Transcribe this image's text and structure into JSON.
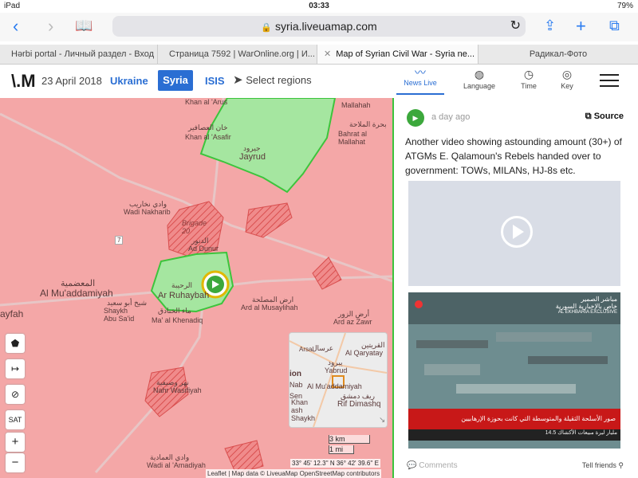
{
  "status": {
    "device": "iPad",
    "time": "03:33",
    "battery": "79%"
  },
  "browser": {
    "url": "syria.liveuamap.com",
    "tabs": [
      {
        "label": "Hərbi portal - Личный раздел - Вход"
      },
      {
        "label": "Страница 7592 | WarOnline.org | И..."
      },
      {
        "label": "Map of Syrian Civil War - Syria ne..."
      },
      {
        "label": "Радикал-Фото"
      }
    ]
  },
  "header": {
    "date": "23 April 2018",
    "links": {
      "ukraine": "Ukraine",
      "syria": "Syria",
      "isis": "ISIS"
    },
    "select_regions": "Select regions",
    "tabs": {
      "news": "News Live",
      "language": "Language",
      "time": "Time",
      "key": "Key"
    }
  },
  "map": {
    "labels": {
      "khan_arus": "Khan al 'Arus",
      "mallahah": "Mallahah",
      "khan_asafir_ar": "خان العصافير",
      "khan_asafir": "Khan al 'Asafir",
      "bahrat_ar": "بحرة الملاحة",
      "bahrat": "Bahrat al Mallahat",
      "jayrud_ar": "جيرود",
      "jayrud": "Jayrud",
      "wadi_ar": "وادي نخاريب",
      "wadi": "Wadi Nakharib",
      "brigade": "Brigade 20",
      "ad_dunur_ar": "الدنور",
      "ad_dunur": "Ad Dunur",
      "muad_ar": "المعضمية",
      "muad": "Al Mu'addamiyah",
      "ayfah": "ayfah",
      "ruhayba_ar": "الرحيبة",
      "ruhayba": "Ar Ruhaybah",
      "shaykh_ar": "شيخ أبو سعيد",
      "shaykh": "Shaykh Abu Sa'id",
      "khenadiq_ar": "ماء الخنادق",
      "khenadiq": "Ma' al Khenadiq",
      "musalah_ar": "ارض المصلحة",
      "musalah": "Ard al Musaylihah",
      "zawr_ar": "أرض الزور",
      "zawr": "Ard az Zawr",
      "nahr_ar": "نهر وصيفية",
      "nahr": "Nahr Wasifiyah",
      "amadiya_ar": "وادي العمادية",
      "amadiya": "Wadi al 'Amadiyah",
      "road": "7"
    },
    "controls": {
      "sat": "SAT",
      "zoom_in": "+",
      "zoom_out": "−"
    },
    "minimap_labels": {
      "arsal": "عرسال",
      "arsal_en": "Arsal",
      "qaryatay": "Al Qaryatay",
      "qaryatay_ar": "القريتين",
      "yabrud": "Yabrud",
      "yabrud_ar": "يبرود",
      "muad": "Al Mu'addamiyah",
      "rif": "Rif Dimashq",
      "rif_ar": "ريف دمشق",
      "khan": "Khan ash Shaykh",
      "nab": "Nab",
      "ion": "ion",
      "sen": "Sen"
    },
    "scale": {
      "km": "3 km",
      "mi": "1 mi"
    },
    "coords": "33° 45' 12.3'' N 36° 42' 39.6'' E",
    "attribution": "Leaflet | Map data © LiveuaMap OpenStreetMap contributors",
    "colors": {
      "regime": "#f4a7a7",
      "rebel": "#a5e6a0",
      "rebel_border": "#3cc43c"
    }
  },
  "post": {
    "time_ago": "a day ago",
    "source": "Source",
    "text": "Another video showing astounding amount (30+) of ATGMs E. Qalamoun's Rebels handed over to government: TOWs, MILANs, HJ-8s etc.",
    "frame": {
      "brand": "مباشر الصمير",
      "brand2": "خاص بالإخبارية السورية",
      "exclusive": "AL EKHBARIA EXCLUSIVE",
      "banner": "صور الأسلحة الثقيلة والمتوسطة التي كانت بحوزة الإرهابيين",
      "ticker": "14.5 مليار ليرة مبيعات الأكشاك"
    },
    "comments": "Comments",
    "tell_friends": "Tell friends"
  }
}
